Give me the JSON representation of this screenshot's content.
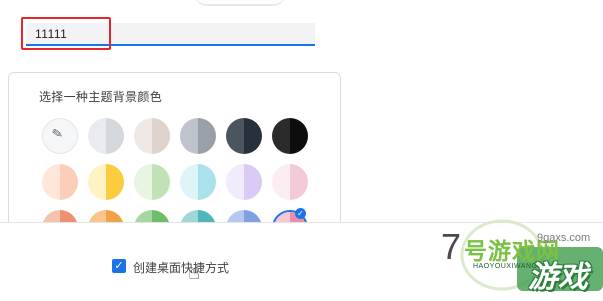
{
  "dialog": {
    "name_input_value": "11111",
    "theme_section_title": "选择一种主题背景颜色",
    "create_shortcut_label": "创建桌面快捷方式",
    "create_shortcut_checked": true
  },
  "swatches": [
    {
      "name": "swatch-custom-picker",
      "icon": "eyedropper-icon"
    },
    {
      "name": "swatch-light-gray",
      "left": "#e9ebee",
      "right": "#d4d7dc"
    },
    {
      "name": "swatch-warm-gray",
      "left": "#efe8e4",
      "right": "#ddd2cc"
    },
    {
      "name": "swatch-mid-gray",
      "left": "#bfc4cc",
      "right": "#9aa0a8"
    },
    {
      "name": "swatch-slate",
      "left": "#4a5560",
      "right": "#27313b"
    },
    {
      "name": "swatch-black",
      "left": "#2b2b2b",
      "right": "#0d0d0d"
    },
    {
      "name": "swatch-peach",
      "left": "#ffe6da",
      "right": "#fccdb7"
    },
    {
      "name": "swatch-yellow",
      "left": "#fff2c4",
      "right": "#fbcd3e"
    },
    {
      "name": "swatch-green",
      "left": "#e7f5e2",
      "right": "#bfe3b4"
    },
    {
      "name": "swatch-cyan",
      "left": "#def5f7",
      "right": "#a9e2ea"
    },
    {
      "name": "swatch-lavender",
      "left": "#f2ebfb",
      "right": "#dbcaf5"
    },
    {
      "name": "swatch-pink",
      "left": "#fcedf3",
      "right": "#f4c9d8"
    },
    {
      "name": "swatch-salmon",
      "left": "#f7c2ad",
      "right": "#ec9272"
    },
    {
      "name": "swatch-orange",
      "left": "#f8c58c",
      "right": "#f0a244"
    },
    {
      "name": "swatch-leaf",
      "left": "#a6d7a0",
      "right": "#6ebd68"
    },
    {
      "name": "swatch-teal",
      "left": "#9dd7d9",
      "right": "#4fb6bb"
    },
    {
      "name": "swatch-blue",
      "left": "#b5c9f0",
      "right": "#7da2e2"
    },
    {
      "name": "swatch-rose",
      "left": "#f5c8d6",
      "right": "#e88fa9"
    }
  ],
  "watermark": {
    "number": "7",
    "site": "9gaxs.com",
    "title": "号游戏网",
    "subtitle": "HAOYOUXIWANG",
    "game": "游戏"
  },
  "colors": {
    "accent": "#1a73e8",
    "highlight_border": "#e5262a"
  }
}
